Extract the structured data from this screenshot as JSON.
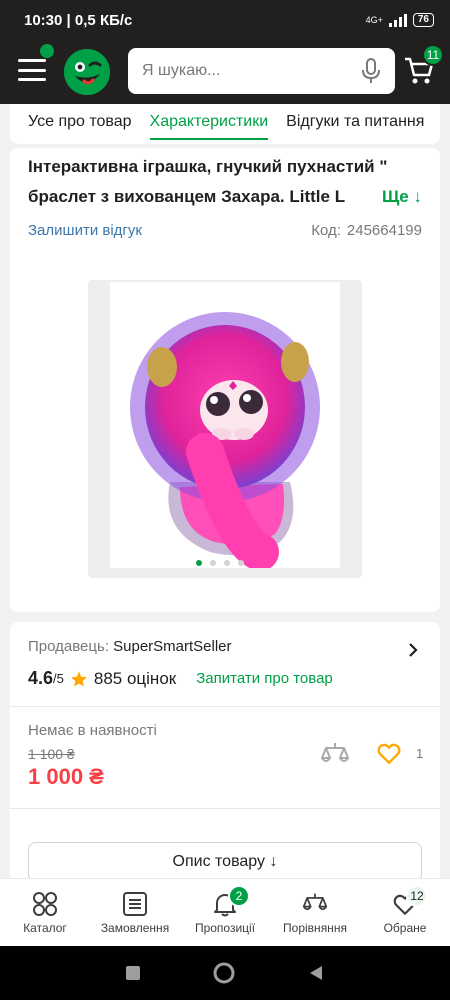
{
  "status_bar": {
    "time": "10:30",
    "speed": "0,5 КБ/с",
    "network": "4G+",
    "battery": "76"
  },
  "header": {
    "search_placeholder": "Я шукаю...",
    "cart_count": "11"
  },
  "tabs": [
    {
      "label": "Усе про товар"
    },
    {
      "label": "Характеристики"
    },
    {
      "label": "Відгуки та питання"
    }
  ],
  "product": {
    "title": "Інтерактивна іграшка, гнучкий пухнастий \" браслет з вихованцем Захара. Little L",
    "more_label": "Ще ↓",
    "review_link": "Залишити відгук",
    "code_label": "Код:",
    "code": "245664199",
    "image_icon": "plush-bracelet-toy-image",
    "gallery": {
      "count": 4,
      "active_index": 0
    }
  },
  "seller": {
    "label": "Продавець:",
    "name": "SuperSmartSeller"
  },
  "rating": {
    "value": "4.6",
    "max": "/5",
    "reviews": "885 оцінок",
    "ask": "Запитати про товар"
  },
  "offer": {
    "availability": "Немає в наявності",
    "old_price": "1 100 ₴",
    "price": "1 000 ₴",
    "favorite_count": "1",
    "description_button": "Опис товару ↓"
  },
  "bottom_nav": [
    {
      "label": "Каталог",
      "icon": "catalog-icon",
      "badge": ""
    },
    {
      "label": "Замовлення",
      "icon": "orders-icon",
      "badge": ""
    },
    {
      "label": "Пропозиції",
      "icon": "bell-icon",
      "badge": "2"
    },
    {
      "label": "Порівняння",
      "icon": "compare-icon",
      "badge": ""
    },
    {
      "label": "Обране",
      "icon": "heart-icon",
      "badge": "12"
    }
  ],
  "colors": {
    "brand": "#00a046",
    "price": "#f84147",
    "link": "#3e77aa",
    "header": "#221f1f"
  }
}
